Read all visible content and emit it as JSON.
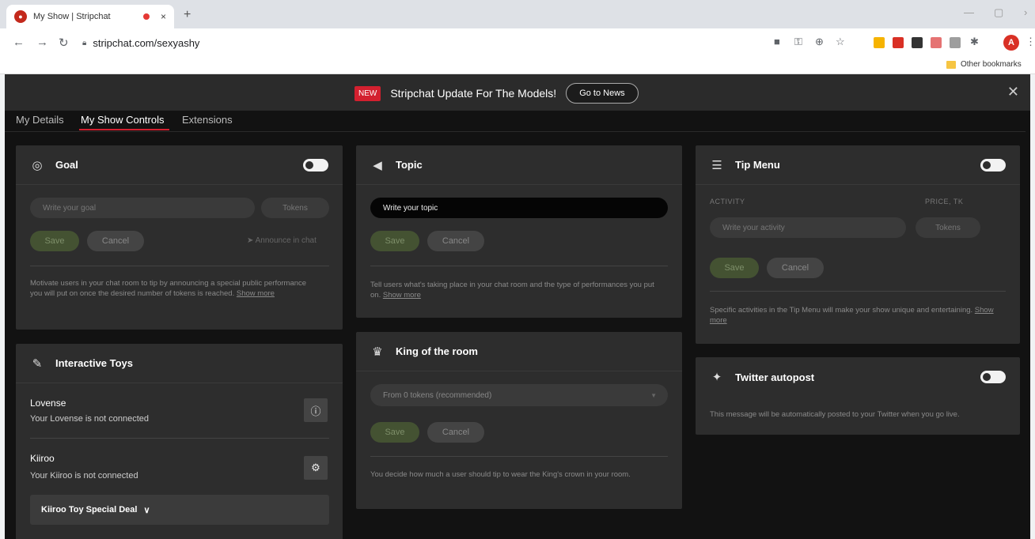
{
  "browser": {
    "tab_title": "My Show | Stripchat",
    "tab_close": "×",
    "new_tab": "+",
    "url": "stripchat.com/sexyashy",
    "other_bookmarks": "Other bookmarks",
    "profile_initial": "A"
  },
  "banner": {
    "badge": "NEW",
    "text": "Stripchat Update For The Models!",
    "button": "Go to News",
    "close": "✕"
  },
  "tabs": [
    "My Details",
    "My Show Controls",
    "Extensions"
  ],
  "goal": {
    "title": "Goal",
    "goal_placeholder": "Write your goal",
    "tokens_placeholder": "Tokens",
    "save": "Save",
    "cancel": "Cancel",
    "announce": "Announce in chat",
    "description": "Motivate users in your chat room to tip by announcing a special public performance you will put on once the desired number of tokens is reached.",
    "show_more": "Show more"
  },
  "toys": {
    "title": "Interactive Toys",
    "lovense_name": "Lovense",
    "lovense_status": "Your Lovense is not connected",
    "kiiroo_name": "Kiiroo",
    "kiiroo_status": "Your Kiiroo is not connected",
    "deal": "Kiiroo Toy Special Deal"
  },
  "topic": {
    "title": "Topic",
    "placeholder": "Write your topic",
    "save": "Save",
    "cancel": "Cancel",
    "description": "Tell users what's taking place in your chat room and the type of performances you put on.",
    "show_more": "Show more"
  },
  "king": {
    "title": "King of the room",
    "select_value": "From 0 tokens (recommended)",
    "save": "Save",
    "cancel": "Cancel",
    "description": "You decide how much a user should tip to wear the King's crown in your room."
  },
  "tipmenu": {
    "title": "Tip Menu",
    "col_activity": "ACTIVITY",
    "col_price": "PRICE, TK",
    "activity_placeholder": "Write your activity",
    "tokens_placeholder": "Tokens",
    "save": "Save",
    "cancel": "Cancel",
    "description": "Specific activities in the Tip Menu will make your show unique and entertaining.",
    "show_more": "Show more"
  },
  "twitter": {
    "title": "Twitter autopost",
    "description": "This message will be automatically posted to your Twitter when you go live."
  }
}
